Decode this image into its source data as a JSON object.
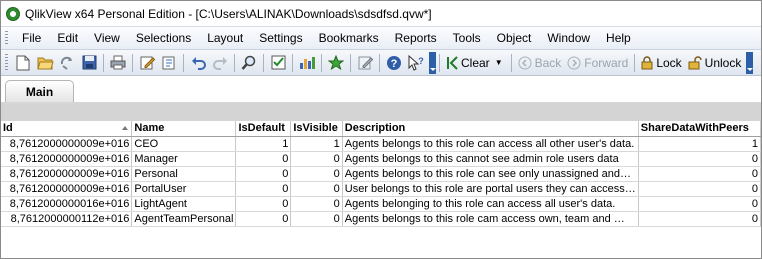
{
  "window": {
    "title": "QlikView x64 Personal Edition - [C:\\Users\\ALINAK\\Downloads\\sdsdfsd.qvw*]"
  },
  "menu": {
    "items": [
      "File",
      "Edit",
      "View",
      "Selections",
      "Layout",
      "Settings",
      "Bookmarks",
      "Reports",
      "Tools",
      "Object",
      "Window",
      "Help"
    ]
  },
  "toolbar": {
    "clear_label": "Clear",
    "back_label": "Back",
    "forward_label": "Forward",
    "lock_label": "Lock",
    "unlock_label": "Unlock",
    "icons": [
      "new-file-icon",
      "open-folder-icon",
      "reload-icon",
      "save-icon",
      "print-icon",
      "edit-script-icon",
      "reload-script-icon",
      "undo-icon",
      "redo-icon",
      "search-icon",
      "selections-icon",
      "chart-icon",
      "bookmark-icon",
      "edit-icon",
      "help-icon",
      "whats-this-icon"
    ]
  },
  "tabs": [
    {
      "label": "Main",
      "active": true
    }
  ],
  "table": {
    "columns": [
      "Id",
      "Name",
      "IsDefault",
      "IsVisible",
      "Description",
      "ShareDataWithPeers"
    ],
    "sorted_column": "Id",
    "rows": [
      [
        "8,7612000000009e+016",
        "CEO",
        "1",
        "1",
        "Agents belongs to this role can access all other user's data.",
        "1"
      ],
      [
        "8,7612000000009e+016",
        "Manager",
        "0",
        "0",
        "Agents belongs to this cannot see admin role users data",
        "0"
      ],
      [
        "8,7612000000009e+016",
        "Personal",
        "0",
        "0",
        "Agents belongs to this role can see only unassigned and…",
        "0"
      ],
      [
        "8,7612000000009e+016",
        "PortalUser",
        "0",
        "0",
        "User belongs to this role are portal users they can access…",
        "0"
      ],
      [
        "8,7612000000016e+016",
        "LightAgent",
        "0",
        "0",
        "Agents belonging to this role can access all user's data.",
        "0"
      ],
      [
        "8,7612000000112e+016",
        "AgentTeamPersonal",
        "0",
        "0",
        "Agents belongs to this role cam access own, team and …",
        "0"
      ]
    ]
  },
  "colors": {
    "toolbar_accent": "#2c5fa8",
    "sheet_background": "#d4d4d4"
  }
}
